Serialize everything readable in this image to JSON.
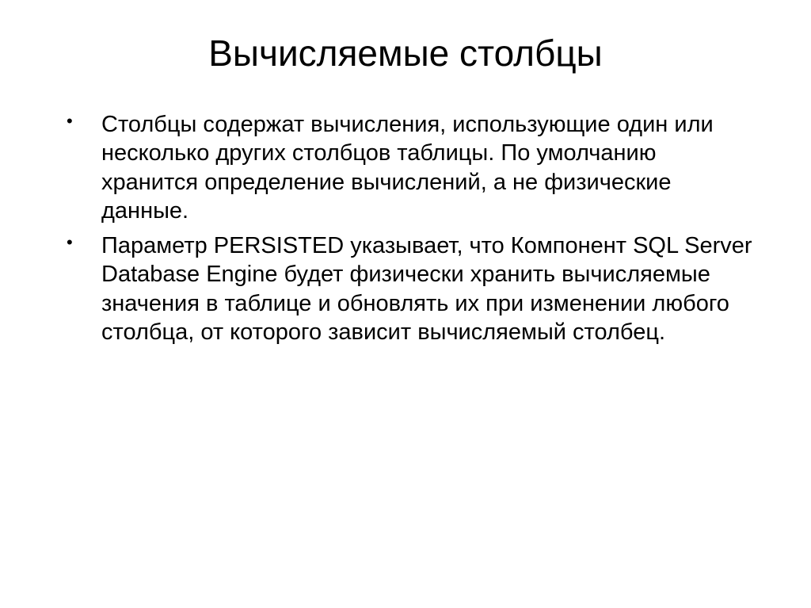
{
  "slide": {
    "title": "Вычисляемые столбцы",
    "bullets": [
      "Столбцы содержат вычисления, использующие один или несколько других столбцов таблицы. По умолчанию хранится определение вычислений, а не физические данные.",
      "Параметр PERSISTED указывает, что Компонент SQL Server Database Engine будет физически хранить вычисляемые значения в таблице и обновлять их при изменении любого столбца, от которого зависит вычисляемый столбец."
    ]
  }
}
